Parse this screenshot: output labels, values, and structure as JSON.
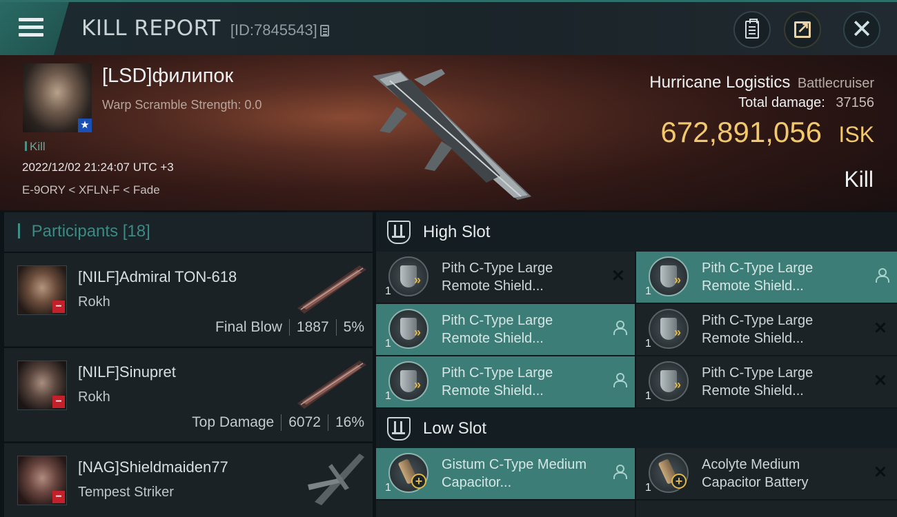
{
  "header": {
    "title": "KILL REPORT",
    "report_id": "[ID:7845543]",
    "menu_icon": "hamburger-menu-icon",
    "buttons": [
      "clipboard-icon",
      "share-icon",
      "close-icon"
    ]
  },
  "victim": {
    "name": "[LSD]филипок",
    "warp_scramble": "Warp Scramble Strength: 0.0",
    "kill_tag": "Kill",
    "timestamp": "2022/12/02 21:24:07 UTC +3",
    "location": "E-9ORY < XFLN-F < Fade",
    "ship_name": "Hurricane Logistics",
    "ship_class": "Battlecruiser",
    "total_damage_label": "Total damage:",
    "total_damage": "37156",
    "isk_value": "672,891,056",
    "isk_unit": "ISK",
    "result": "Kill"
  },
  "participants": {
    "label": "Participants",
    "count": "[18]",
    "items": [
      {
        "name": "[NILF]Admiral TON-618",
        "ship": "Rokh",
        "tag": "Final Blow",
        "damage": "1887",
        "percent": "5%"
      },
      {
        "name": "[NILF]Sinupret",
        "ship": "Rokh",
        "tag": "Top Damage",
        "damage": "6072",
        "percent": "16%"
      },
      {
        "name": "[NAG]Shieldmaiden77",
        "ship": "Tempest Striker",
        "tag": "",
        "damage": "",
        "percent": ""
      }
    ]
  },
  "slots": {
    "high": {
      "title": "High Slot",
      "modules": [
        {
          "qty": "1",
          "name": "Pith C-Type Large Remote Shield...",
          "state": "destroyed"
        },
        {
          "qty": "1",
          "name": "Pith C-Type Large Remote Shield...",
          "state": "dropped"
        },
        {
          "qty": "1",
          "name": "Pith C-Type Large Remote Shield...",
          "state": "dropped"
        },
        {
          "qty": "1",
          "name": "Pith C-Type Large Remote Shield...",
          "state": "destroyed"
        },
        {
          "qty": "1",
          "name": "Pith C-Type Large Remote Shield...",
          "state": "dropped"
        },
        {
          "qty": "1",
          "name": "Pith C-Type Large Remote Shield...",
          "state": "destroyed"
        }
      ]
    },
    "low": {
      "title": "Low Slot",
      "modules": [
        {
          "qty": "1",
          "name": "Gistum C-Type Medium Capacitor...",
          "state": "dropped"
        },
        {
          "qty": "1",
          "name": "Acolyte Medium Capacitor Battery",
          "state": "destroyed"
        }
      ]
    }
  },
  "colors": {
    "accent_teal": "#3d7d78",
    "isk_gold": "#f2c86c",
    "hostile_red": "#c4202a",
    "corp_blue": "#1c4fb4"
  }
}
